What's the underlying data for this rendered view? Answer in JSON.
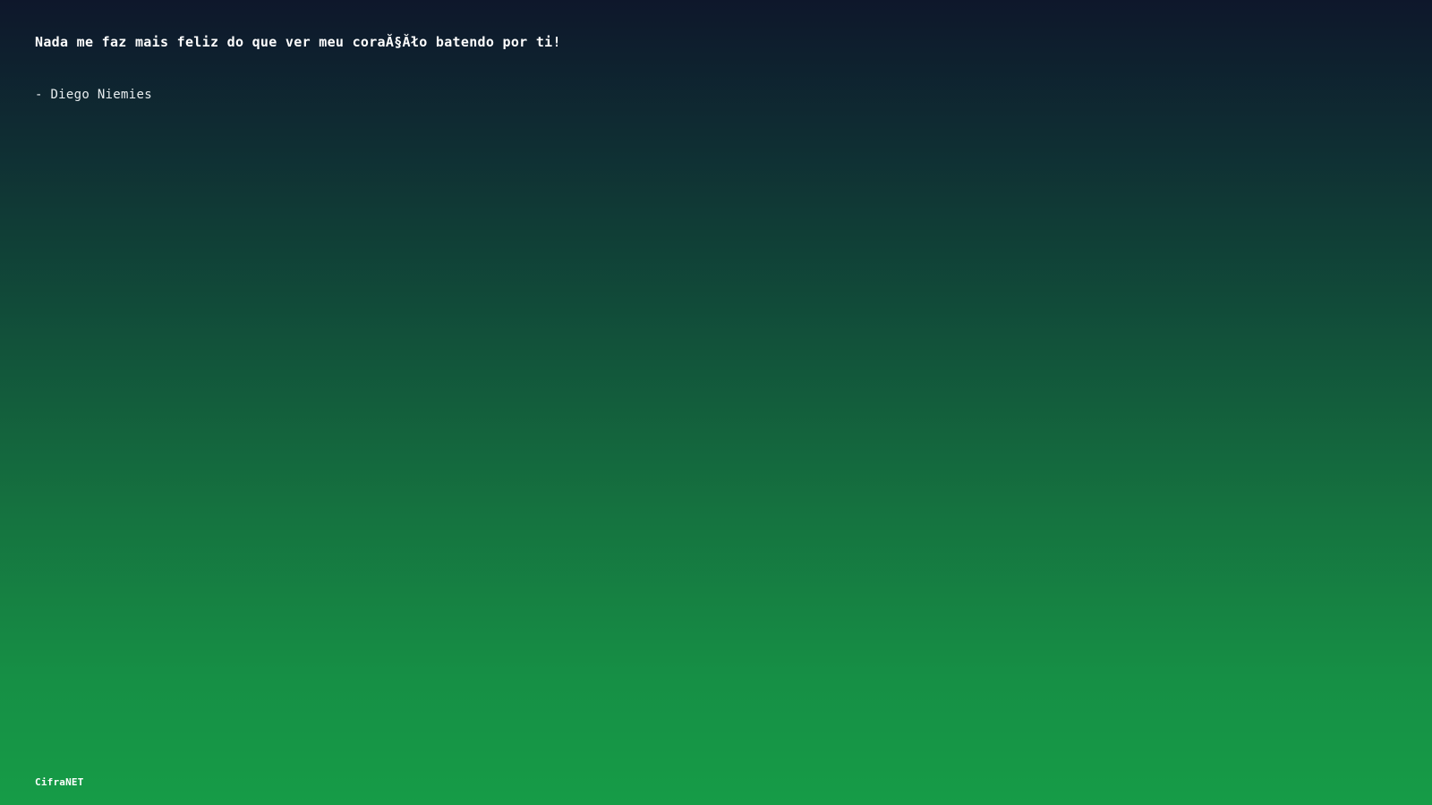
{
  "quote": {
    "text": "Nada me faz mais feliz do que ver meu coraĂ§Ăło batendo por ti!",
    "author": "- Diego Niemies"
  },
  "footer": {
    "brand": "CifraNET"
  },
  "colors": {
    "gradient_top": "#0e172b",
    "gradient_bottom": "#169c47",
    "text": "#ffffff"
  }
}
